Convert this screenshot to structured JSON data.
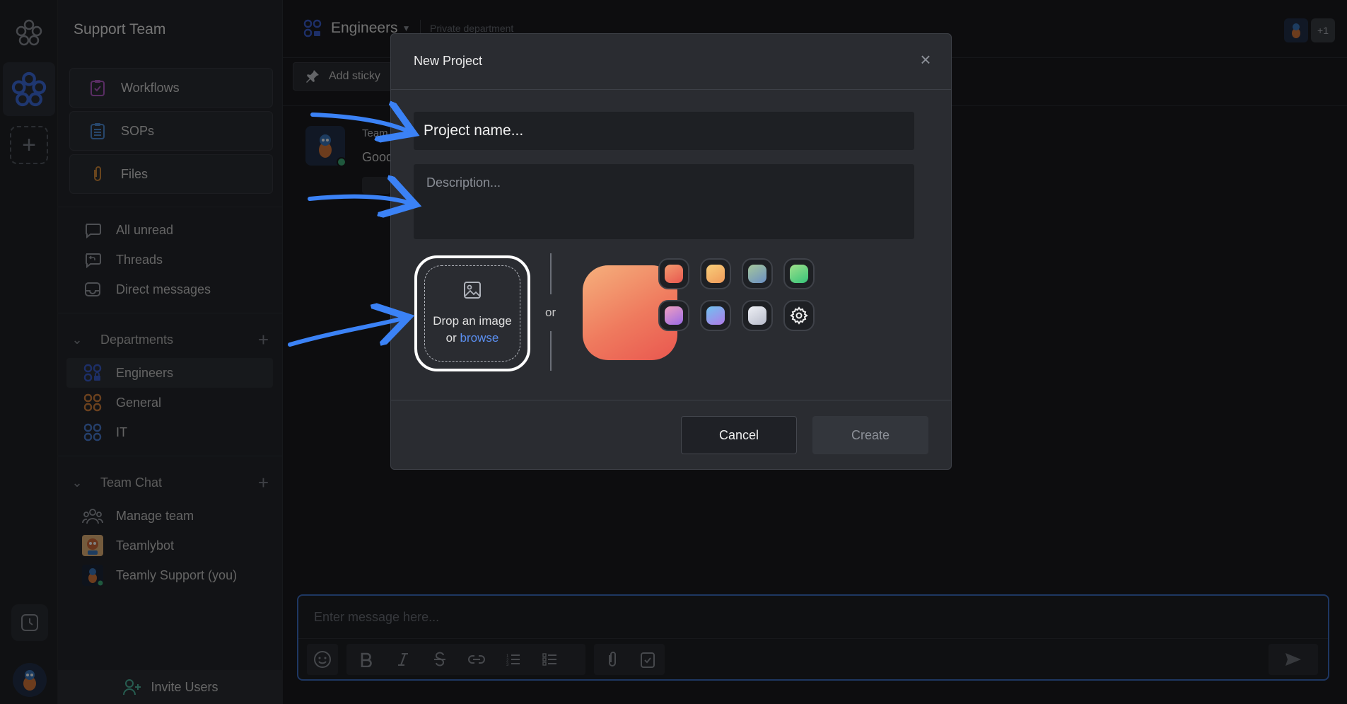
{
  "sidebar": {
    "team_name": "Support Team",
    "boxes": [
      {
        "label": "Workflows",
        "icon": "clipboard-check-icon"
      },
      {
        "label": "SOPs",
        "icon": "list-clipboard-icon"
      },
      {
        "label": "Files",
        "icon": "paperclip-icon"
      }
    ],
    "inbox": [
      {
        "label": "All unread",
        "icon": "chat-bubble-icon"
      },
      {
        "label": "Threads",
        "icon": "thread-reply-icon"
      },
      {
        "label": "Direct messages",
        "icon": "inbox-icon"
      }
    ],
    "departments_heading": "Departments",
    "departments": [
      {
        "label": "Engineers",
        "icon": "department-lock-icon",
        "color": "#3b5fd0"
      },
      {
        "label": "General",
        "icon": "department-icon",
        "color": "#d6823c"
      },
      {
        "label": "IT",
        "icon": "department-icon",
        "color": "#4b7fd6"
      }
    ],
    "team_chat_heading": "Team Chat",
    "team_chat": [
      {
        "label": "Manage team",
        "icon": "team-icon"
      },
      {
        "label": "Teamlybot",
        "icon": "bot-avatar-icon"
      },
      {
        "label": "Teamly Support (you)",
        "icon": "user-avatar-icon"
      }
    ],
    "invite_label": "Invite Users"
  },
  "topbar": {
    "department": "Engineers",
    "privacy": "Private department",
    "extra_members": "+1"
  },
  "toolbar": {
    "add_sticky": "Add sticky"
  },
  "message": {
    "author": "Team",
    "text": "Good"
  },
  "composer": {
    "placeholder": "Enter message here..."
  },
  "modal": {
    "title": "New Project",
    "name_placeholder": "Project name...",
    "description_placeholder": "Description...",
    "drop_line1": "Drop an image",
    "drop_or": "or",
    "drop_browse": "browse",
    "or_divider": "or",
    "cancel_label": "Cancel",
    "create_label": "Create",
    "colors": [
      "#ef6f5a",
      "#f5b36a",
      "#7fa3b8",
      "#4fcf84",
      "#c07ae0",
      "#8f7ff0",
      "#d0d3dc"
    ],
    "settings_icon": "gear-icon"
  },
  "accent": "#3d6fc4",
  "annotation_arrow_color": "#3b82f6"
}
